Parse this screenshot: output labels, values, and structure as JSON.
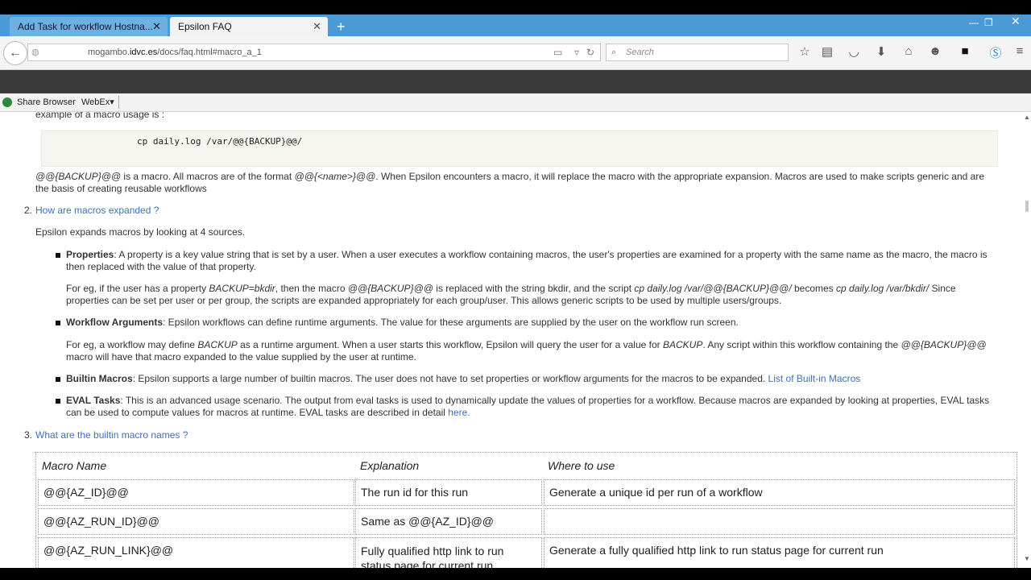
{
  "browser": {
    "tabs": [
      {
        "label": "Add Task for workflow Hostna...",
        "active": false
      },
      {
        "label": "Epsilon FAQ",
        "active": true
      }
    ],
    "url": {
      "prefix": "mogambo.",
      "domain": "idvc.es",
      "path": "/docs/faq.html#macro_a_1"
    },
    "search_placeholder": "Search",
    "bookmarks": [
      "Share Browser",
      "WebEx▾"
    ],
    "accent_color": "#4a9ad7"
  },
  "page": {
    "intro_fragment": "example of a macro usage is :",
    "code_example": "cp daily.log /var/@@{BACKUP}@@/",
    "macro_desc": {
      "m1": "@@{BACKUP}@@",
      "t1": " is a macro. All macros are of the format ",
      "m2": "@@{<name>}@@",
      "t2": ". When Epsilon encounters a macro, it will replace the macro with the appropriate expansion. Macros are used to make scripts generic and are",
      "line2": "the basis of creating reusable workflows"
    },
    "q2": {
      "num": "2.",
      "title": "How are macros expanded ?"
    },
    "q2_intro": "Epsilon expands macros by looking at 4 sources.",
    "properties": {
      "title": "Properties",
      "line1": ": A property is a key value string that is set by a user. When a user executes a workflow containing macros, the user's properties are examined for a property with the same name as the macro, the macro is",
      "line2": "then replaced with the value of that property.",
      "eg_a": "For eg, if the user has a property ",
      "eg_b": "BACKUP=bkdir",
      "eg_c": ", then the macro ",
      "eg_d": "@@{BACKUP}@@",
      "eg_e": " is replaced with the string bkdir, and the script ",
      "eg_f": "cp daily.log /var/@@{BACKUP}@@/",
      "eg_g": " becomes ",
      "eg_h": "cp daily.log /var/bkdir/",
      "eg_i": " Since",
      "eg_line2": "properties can be set per user or per group, the scripts are expanded appropriately for each group/user. This allows generic scripts to be used by multiple users/groups."
    },
    "workflow_args": {
      "title": "Workflow Arguments",
      "line1": ": Epsilon workflows can define runtime arguments. The value for these arguments are supplied by the user on the workflow run screen.",
      "eg_a": "For eg, a workflow may define ",
      "eg_b": "BACKUP",
      "eg_c": " as a runtime argument. When a user starts this workflow, Epsilon will query the user for a value for ",
      "eg_d": "BACKUP",
      "eg_e": ". Any script within this workflow containing the ",
      "eg_f": "@@{BACKUP}@@",
      "eg_line2": "macro will have that macro expanded to the value supplied by the user at runtime."
    },
    "builtin": {
      "title": "Builtin Macros",
      "text": ": Epsilon supports a large number of builtin macros. The user does not have to set properties or workflow arguments for the macros to be expanded. ",
      "link": "List of Built-in Macros"
    },
    "eval": {
      "title": "EVAL Tasks",
      "line1": ": This is an advanced usage scenario. The output from eval tasks is used to dynamically update the values of properties for a workflow. Because macros are expanded by looking at properties, EVAL tasks",
      "line2": "can be used to compute values for macros at runtime. EVAL tasks are described in detail ",
      "link": "here."
    },
    "q3": {
      "num": "3.",
      "title": "What are the builtin macro names ?"
    },
    "table": {
      "headers": [
        "Macro Name",
        "Explanation",
        "Where to use"
      ],
      "rows": [
        [
          "@@{AZ_ID}@@",
          "The run id for this run",
          "Generate a unique id per run of a workflow"
        ],
        [
          "@@{AZ_RUN_ID}@@",
          "Same as @@{AZ_ID}@@",
          ""
        ],
        [
          "@@{AZ_RUN_LINK}@@",
          "Fully qualified http link to run",
          "Generate a fully qualified http link to run status page for current run"
        ]
      ],
      "row3_explanation_line2": "status page for current run"
    }
  }
}
